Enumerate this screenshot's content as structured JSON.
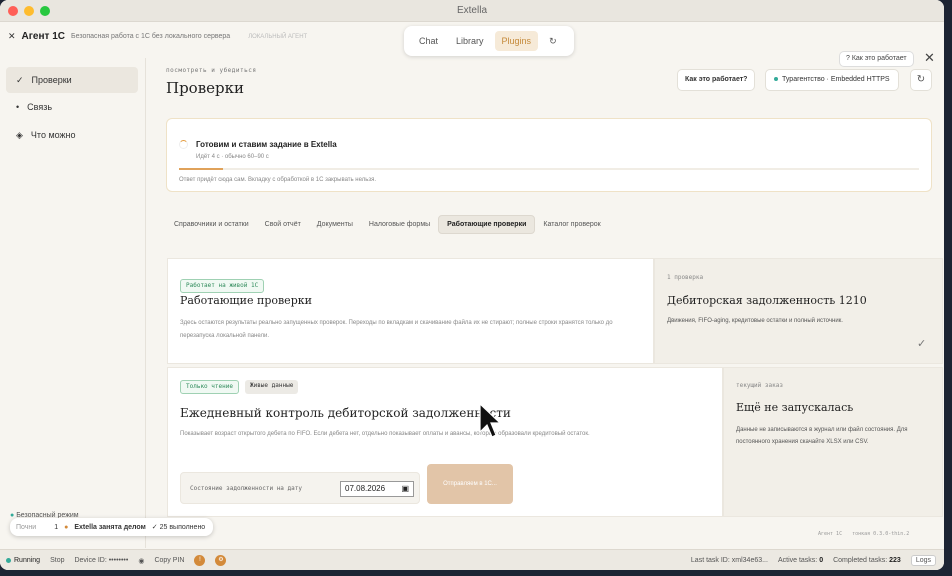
{
  "window": {
    "title": "Extella"
  },
  "appbar": {
    "brand": "Агент 1С",
    "subtitle": "Безопасная работа с 1С без локального сервера",
    "ghost": "ЛОКАЛЬНЫЙ АГЕНТ",
    "tabs": [
      "Chat",
      "Library",
      "Plugins"
    ],
    "active_tab": "Plugins",
    "how_label": "? Как это работает",
    "close": "✕"
  },
  "sidebar": {
    "items": [
      {
        "icon": "✓",
        "label": "Проверки",
        "active": true
      },
      {
        "icon": "•",
        "label": "Связь",
        "active": false
      },
      {
        "icon": "◈",
        "label": "Что можно",
        "active": false
      }
    ],
    "safe_mode": "Безопасный режим",
    "toast": {
      "start": "Почни",
      "num": "1",
      "busy": "Extella занята делом",
      "done": "✓ 25 выполнено"
    }
  },
  "header": {
    "kicker": "посмотреть и убедиться",
    "title": "Проверки",
    "how_button": "Как это работает?",
    "connection": "Турагентство · Embedded HTTPS",
    "refresh": "↻"
  },
  "progress": {
    "title": "Готовим и ставим задание в Extella",
    "sub": "Идёт 4 с · обычно 60–90 с",
    "note": "Ответ придёт сюда сам. Вкладку с обработкой в 1С закрывать нельзя.",
    "fraction": 0.06
  },
  "tabs": [
    "Справочники и остатки",
    "Свой отчёт",
    "Документы",
    "Налоговые формы",
    "Работающие проверки",
    "Каталог проверок"
  ],
  "active_tab_index": 4,
  "card1": {
    "tag": "Работает на живой 1С",
    "title": "Работающие проверки",
    "text": "Здесь остаются результаты реально запущенных проверок. Переходы по вкладкам и скачивание файла их не стирают; полные строки хранятся только до перезапуска локальной панели.",
    "side_kicker": "1 проверка",
    "side_title": "Дебиторская задолженность 1210",
    "side_desc": "Движения, FIFO-aging, кредитовые остатки и полный источник.",
    "check": "✓"
  },
  "card2": {
    "tag1": "Только чтение",
    "tag2": "Живые данные",
    "title": "Ежедневный контроль дебиторской задолженности",
    "text": "Показывает возраст открытого дебета по FIFO. Если дебета нет, отдельно показывает оплаты и авансы, которые образовали кредитовый остаток.",
    "form_label": "Состояние задолженности на дату",
    "date": "07.08.2026",
    "button": "Отправляем в 1С...",
    "side_kicker": "текущий заказ",
    "side_title": "Ещё не запускалась",
    "side_desc": "Данные не записываются в журнал или файл состояния. Для постоянного хранения скачайте XLSX или CSV."
  },
  "version": {
    "agent": "Агент 1С",
    "ver": "тонкая 0.3.0-thin.2"
  },
  "status": {
    "running": "Running",
    "stop": "Stop",
    "device": "Device ID: ••••••••",
    "copy": "Copy PIN",
    "last_task": "Last task ID: ",
    "last_task_val": "xml34e63...",
    "active": "Active tasks: ",
    "active_val": "0",
    "completed": "Completed tasks: ",
    "completed_val": "223",
    "logs": "Logs"
  },
  "colors": {
    "accent": "#c58a3a",
    "green": "#33aa99",
    "dot_red": "#ff5f57",
    "dot_yellow": "#febc2e",
    "dot_green": "#28c840"
  }
}
